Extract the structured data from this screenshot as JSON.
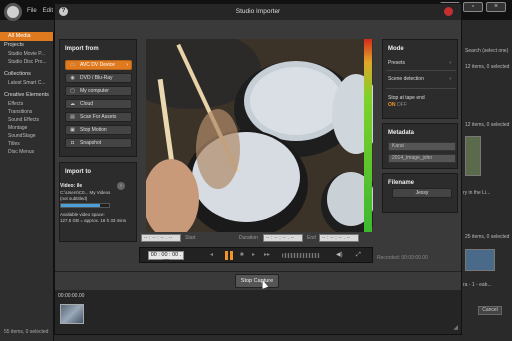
{
  "background_app": {
    "menu": [
      "File",
      "Edit"
    ],
    "sidebar": {
      "all_media": "All Media",
      "projects_header": "Projects",
      "projects": [
        "Studio Movie P...",
        "Studio Disc Pro..."
      ],
      "collections_header": "Collections",
      "collections": [
        "Latest Smart C..."
      ],
      "creative_header": "Creative Elements",
      "creative": [
        "Effects",
        "Transitions",
        "Sound Effects",
        "Montage",
        "SoundStage",
        "Titles",
        "Disc Menus"
      ],
      "footer": "55 items, 0 selected"
    },
    "right_panel": {
      "search_hint": "Search (select one)",
      "count_top": "12 items, 0 selected",
      "count_mid": "12 items, 0 selected",
      "count_bot": "25 items, 0 selected",
      "thumb_caption": "ry in the Li...",
      "thumb_caption_2": "ra - 1 - eab...",
      "cancel_label": "Cancel"
    }
  },
  "dialog": {
    "title": "Studio Importer",
    "help_icon": "?",
    "import_from": {
      "title": "Import from",
      "items": [
        {
          "icon": "camcorder-icon",
          "glyph": "▭",
          "label": "AVC DV Device",
          "active": true
        },
        {
          "icon": "disc-icon",
          "glyph": "◉",
          "label": "DVD / Blu-Ray",
          "active": false
        },
        {
          "icon": "computer-icon",
          "glyph": "▢",
          "label": "My computer",
          "active": false
        },
        {
          "icon": "cloud-icon",
          "glyph": "☁",
          "label": "Cloud",
          "active": false
        },
        {
          "icon": "scan-icon",
          "glyph": "▤",
          "label": "Scan For Assets",
          "active": false
        },
        {
          "icon": "stop-motion-icon",
          "glyph": "▣",
          "label": "Stop Motion",
          "active": false
        },
        {
          "icon": "camera-icon",
          "glyph": "◘",
          "label": "Snapshot",
          "active": false
        }
      ]
    },
    "import_to": {
      "title": "Import to",
      "video_label": "Video: ile",
      "path_1": "C:\\Users\\C0...  My Videos",
      "path_2": "(not subtitled)",
      "space_label": "Available video space:",
      "space_value": "127.5 GB = approx. 16 h 33 mins",
      "space_used_fraction": 0.82
    },
    "timecode": {
      "start_label": "Start",
      "duration_label": "Duration",
      "end_label": "End",
      "start_value": "-- : -- : -- . --",
      "duration_value": "-- : -- : -- . --",
      "end_value": "-- : -- : -- . --",
      "current": "00 : 00 : 00 . 00",
      "recorded_label": "Recorded:  00:00:00.00"
    },
    "mode": {
      "title": "Mode",
      "presets": "Presets",
      "scene_detection": "Scene detection",
      "stop_at_tape_end": "Stop at tape end",
      "toggle_on": "ON",
      "toggle_off": "OFF"
    },
    "metadata": {
      "title": "Metadata",
      "field_1": "Karat",
      "field_2": "2014_Image_john"
    },
    "filename": {
      "title": "Filename",
      "value": "Jessy"
    },
    "stop_capture": "Stop Capture",
    "timeline_time": "00:00:00.00"
  },
  "colors": {
    "accent": "#e07a1f",
    "panel": "#2c2c2c",
    "dialog": "#3a3a3a"
  }
}
